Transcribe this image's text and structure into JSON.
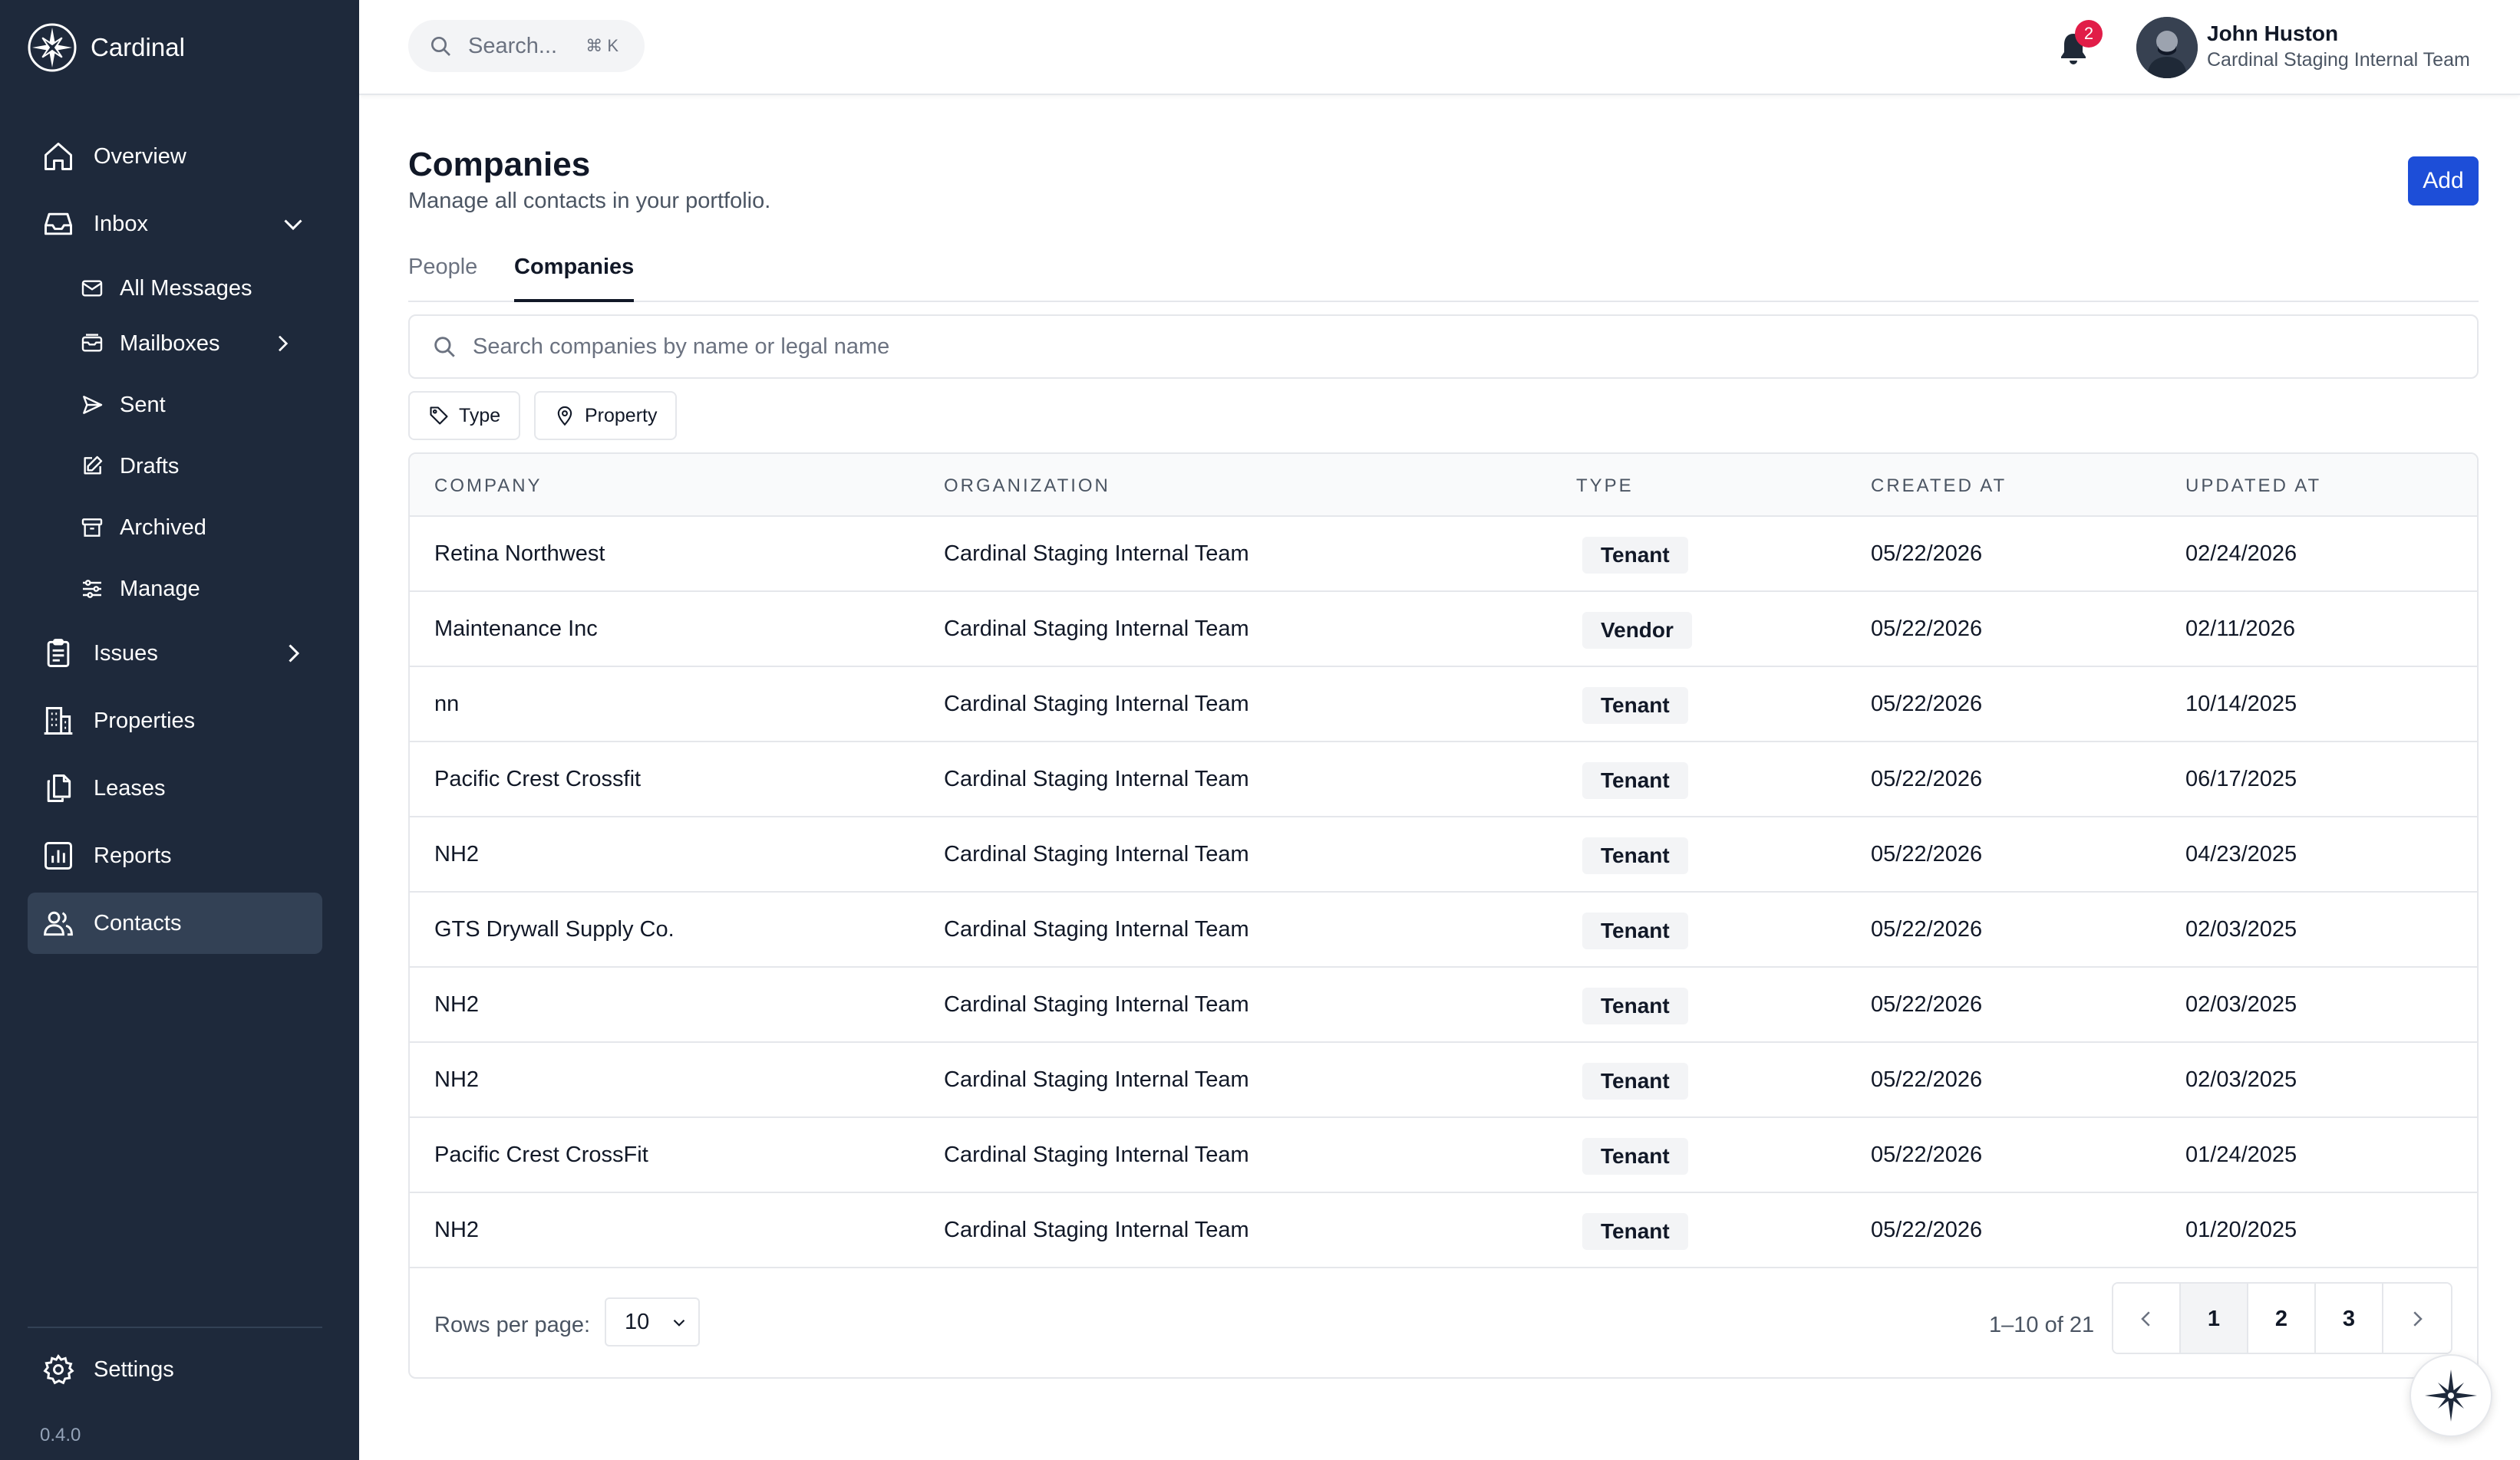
{
  "app": {
    "name": "Cardinal",
    "version": "0.4.0"
  },
  "sidebar": {
    "overview": "Overview",
    "inbox": "Inbox",
    "inbox_children": {
      "all_messages": "All Messages",
      "mailboxes": "Mailboxes",
      "sent": "Sent",
      "drafts": "Drafts",
      "archived": "Archived",
      "manage": "Manage"
    },
    "issues": "Issues",
    "properties": "Properties",
    "leases": "Leases",
    "reports": "Reports",
    "contacts": "Contacts",
    "settings": "Settings",
    "active_item": "Contacts"
  },
  "topbar": {
    "search_placeholder": "Search...",
    "search_shortcut": "⌘ K",
    "notification_count": "2",
    "user_name": "John Huston",
    "user_org": "Cardinal Staging Internal Team"
  },
  "page": {
    "title": "Companies",
    "subtitle": "Manage all contacts in your portfolio.",
    "add_label": "Add",
    "tabs": {
      "people": "People",
      "companies": "Companies"
    },
    "active_tab": "Companies",
    "search_placeholder": "Search companies by name or legal name",
    "filters": {
      "type": "Type",
      "property": "Property"
    }
  },
  "table": {
    "headers": {
      "company": "COMPANY",
      "organization": "ORGANIZATION",
      "type": "TYPE",
      "created_at": "CREATED AT",
      "updated_at": "UPDATED AT"
    },
    "rows": [
      {
        "company": "Retina Northwest",
        "organization": "Cardinal Staging Internal Team",
        "type": "Tenant",
        "created_at": "05/22/2026",
        "updated_at": "02/24/2026"
      },
      {
        "company": "Maintenance Inc",
        "organization": "Cardinal Staging Internal Team",
        "type": "Vendor",
        "created_at": "05/22/2026",
        "updated_at": "02/11/2026"
      },
      {
        "company": "nn",
        "organization": "Cardinal Staging Internal Team",
        "type": "Tenant",
        "created_at": "05/22/2026",
        "updated_at": "10/14/2025"
      },
      {
        "company": "Pacific Crest Crossfit",
        "organization": "Cardinal Staging Internal Team",
        "type": "Tenant",
        "created_at": "05/22/2026",
        "updated_at": "06/17/2025"
      },
      {
        "company": "NH2",
        "organization": "Cardinal Staging Internal Team",
        "type": "Tenant",
        "created_at": "05/22/2026",
        "updated_at": "04/23/2025"
      },
      {
        "company": "GTS Drywall Supply Co.",
        "organization": "Cardinal Staging Internal Team",
        "type": "Tenant",
        "created_at": "05/22/2026",
        "updated_at": "02/03/2025"
      },
      {
        "company": "NH2",
        "organization": "Cardinal Staging Internal Team",
        "type": "Tenant",
        "created_at": "05/22/2026",
        "updated_at": "02/03/2025"
      },
      {
        "company": "NH2",
        "organization": "Cardinal Staging Internal Team",
        "type": "Tenant",
        "created_at": "05/22/2026",
        "updated_at": "02/03/2025"
      },
      {
        "company": "Pacific Crest CrossFit",
        "organization": "Cardinal Staging Internal Team",
        "type": "Tenant",
        "created_at": "05/22/2026",
        "updated_at": "01/24/2025"
      },
      {
        "company": "NH2",
        "organization": "Cardinal Staging Internal Team",
        "type": "Tenant",
        "created_at": "05/22/2026",
        "updated_at": "01/20/2025"
      }
    ],
    "footer": {
      "rows_per_page_label": "Rows per page:",
      "rows_per_page_value": "10",
      "range": "1–10 of 21",
      "pages": [
        "1",
        "2",
        "3"
      ],
      "current_page": "1"
    }
  },
  "colors": {
    "sidebar_bg": "#1e293b",
    "sidebar_active": "#334155",
    "primary": "#1d4ed8",
    "badge_red": "#e11d48"
  },
  "icons": {
    "brand": "compass-star-icon",
    "overview": "home-icon",
    "inbox": "inbox-tray-icon",
    "issues": "clipboard-icon",
    "properties": "building-icon",
    "leases": "documents-icon",
    "reports": "bar-chart-icon",
    "contacts": "users-icon",
    "settings": "gear-icon",
    "notifications": "bell-icon"
  }
}
